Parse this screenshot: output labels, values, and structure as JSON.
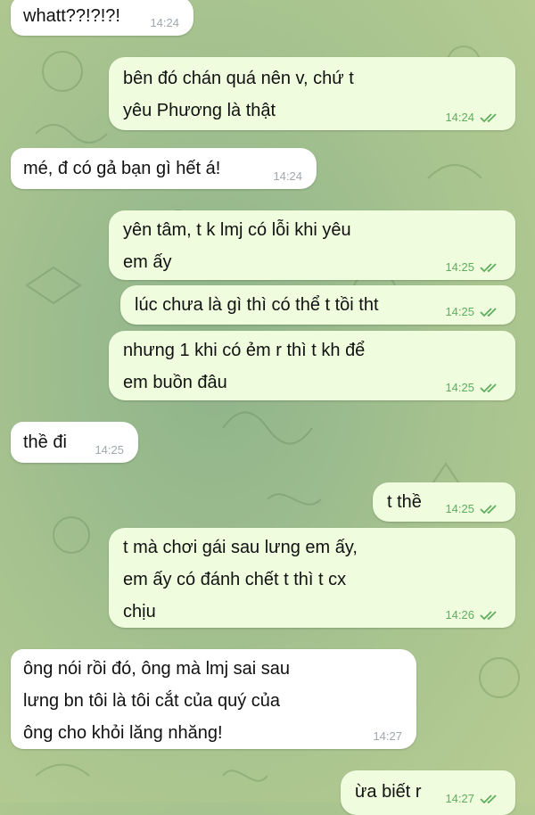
{
  "messages": [
    {
      "dir": "in",
      "text": "whatt??!?!?!",
      "time": "14:24"
    },
    {
      "dir": "out",
      "text": "bên đó chán quá nên v, chứ t\nyêu Phương là thật",
      "time": "14:24"
    },
    {
      "dir": "in",
      "text": "mé, đ có gả bạn gì hết á!",
      "time": "14:24"
    },
    {
      "dir": "out",
      "text": "yên tâm, t k lmj có lỗi khi yêu\nem ấy",
      "time": "14:25"
    },
    {
      "dir": "out",
      "text": "lúc chưa là gì thì có thể t tồi tht",
      "time": "14:25"
    },
    {
      "dir": "out",
      "text": "nhưng 1 khi có ẻm r thì t kh để\nem buồn đâu",
      "time": "14:25"
    },
    {
      "dir": "in",
      "text": "thề đi",
      "time": "14:25"
    },
    {
      "dir": "out",
      "text": "t thề",
      "time": "14:25"
    },
    {
      "dir": "out",
      "text": "t mà chơi gái sau lưng em ấy,\nem ấy có đánh chết t thì t cx\nchịu",
      "time": "14:26"
    },
    {
      "dir": "in",
      "text": "ông nói rồi đó, ông mà lmj sai sau\nlưng bn tôi là tôi cắt của quý của\nông cho khỏi lăng nhăng!",
      "time": "14:27"
    },
    {
      "dir": "out",
      "text": "ừa biết r",
      "time": "14:27"
    }
  ],
  "colors": {
    "incoming_bubble": "#ffffff",
    "outgoing_bubble": "#effdde",
    "outgoing_time": "#5eae5e",
    "incoming_time": "#a0a7ad"
  },
  "icons": {
    "read_receipt": "double-check-icon"
  }
}
